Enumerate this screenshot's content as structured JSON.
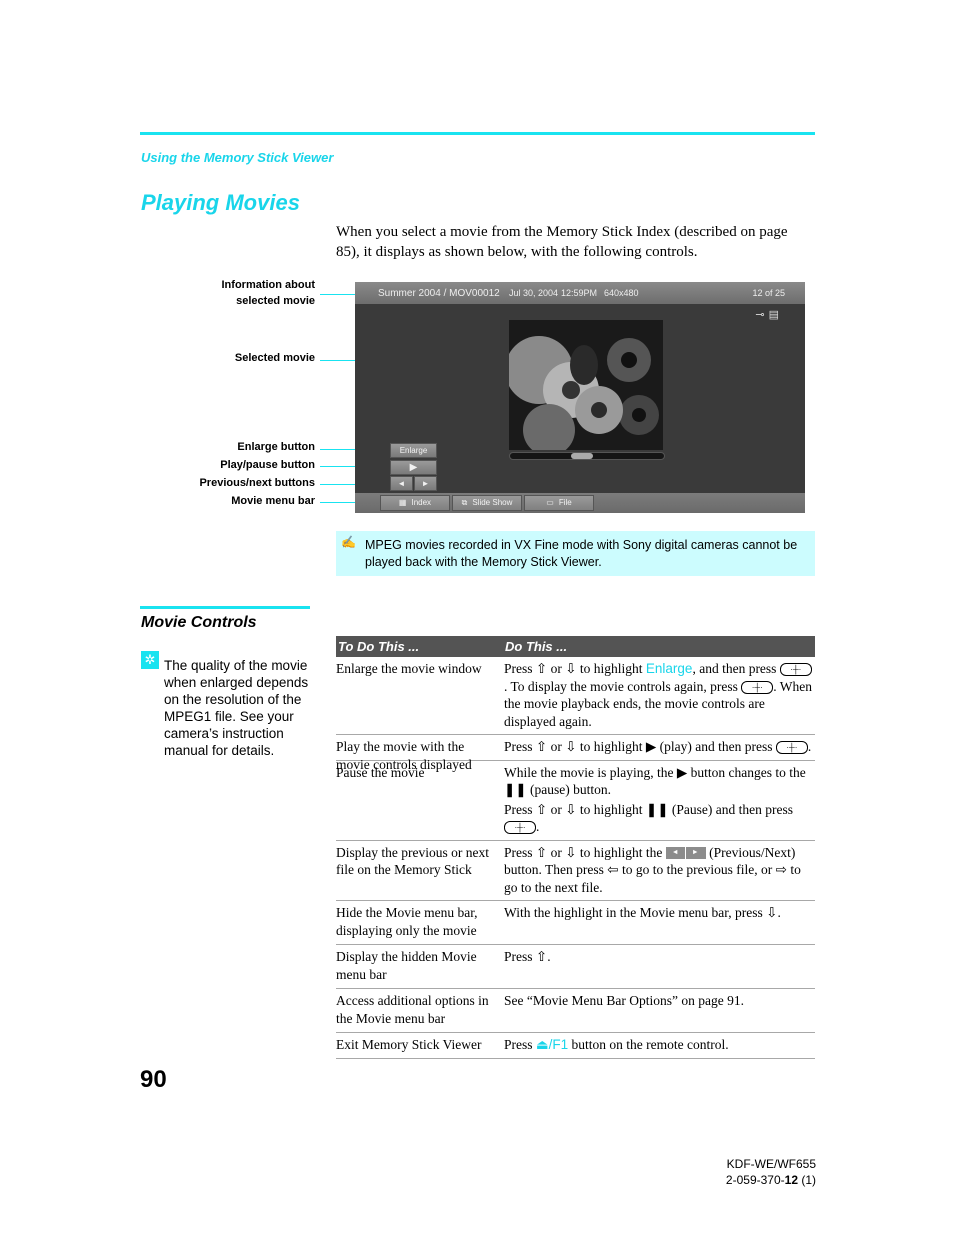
{
  "running_head": "Using the Memory Stick Viewer",
  "page_title": "Playing Movies",
  "intro": "When you select a movie from the Memory Stick Index (described on page 85), it displays as shown below, with the following controls.",
  "callouts": {
    "info_line1": "Information about",
    "info_line2": "selected movie",
    "selected_movie": "Selected movie",
    "enlarge_button": "Enlarge button",
    "play_pause_button": "Play/pause button",
    "prev_next_buttons": "Previous/next buttons",
    "movie_menu_bar": "Movie menu bar"
  },
  "screen": {
    "title": "Summer 2004 / MOV00012",
    "date": "Jul 30, 2004",
    "time": "12:59PM",
    "resolution": "640x480",
    "count": "12 of 25",
    "icons": [
      "key-icon",
      "film-icon"
    ],
    "progress_fraction": 0.46,
    "enlarge_label": "Enlarge",
    "play_glyph": "▶",
    "prev_glyph": "◄",
    "next_glyph": "►",
    "menu": {
      "index": "Index",
      "slide_show": "Slide Show",
      "file": "File"
    }
  },
  "note": {
    "icon": "✍",
    "text": "MPEG movies recorded in VX Fine mode with Sony digital cameras cannot be played back with the Memory Stick Viewer."
  },
  "section": {
    "title": "Movie Controls",
    "tip": "The quality of the movie when enlarged depends on the resolution of the MPEG1 file. See your camera’s instruction manual for details."
  },
  "table": {
    "headers": [
      "To Do This ...",
      "Do This ..."
    ],
    "rows": [
      {
        "task": "Enlarge the movie window",
        "p1_a": "Press ",
        "p1_b": " or ",
        "p1_c": " to highlight ",
        "p1_hl": "Enlarge",
        "p1_d": ", and then press ",
        "p1_e": ". To display the movie controls again, press ",
        "p1_f": ". When the movie playback ends, the movie controls are displayed again."
      },
      {
        "task": "Play the movie with the movie controls displayed",
        "p1_a": "Press ",
        "p1_b": " or ",
        "p1_c": " to highlight ",
        "p1_d": " (play) and then press ",
        "p1_e": "."
      },
      {
        "task": "Pause the movie",
        "p1_a": "While the movie is playing, the ",
        "p1_b": " button changes to the ",
        "p1_c": " (pause) button.",
        "p2_a": "Press ",
        "p2_b": " or ",
        "p2_c": " to highlight ",
        "p2_d": " (Pause) and then press ",
        "p2_e": "."
      },
      {
        "task": "Display the previous or next file on the Memory Stick",
        "p1_a": "Press ",
        "p1_b": " or ",
        "p1_c": " to highlight the ",
        "p1_d": " (Previous/Next) button. Then press ",
        "p1_e": " to go to the previous file, or ",
        "p1_f": " to go to the next file."
      },
      {
        "task": "Hide the Movie menu bar, displaying only the movie",
        "p1_a": "With the highlight in the Movie menu bar, press ",
        "p1_b": "."
      },
      {
        "task": "Display the hidden Movie menu bar",
        "p1_a": "Press ",
        "p1_b": "."
      },
      {
        "task": "Access additional options in the Movie menu bar",
        "p1_a": "See “Movie Menu Bar Options” on page 91."
      },
      {
        "task": "Exit Memory Stick Viewer",
        "p1_a": "Press ",
        "p1_hl": "/F1",
        "p1_b": " button on the remote control."
      }
    ],
    "glyphs": {
      "up": "⇧",
      "down": "⇩",
      "left": "⇦",
      "right": "⇨",
      "play": "▶",
      "pause": "❚❚",
      "joystick": "·┼·",
      "exit": "⏏"
    }
  },
  "footer": {
    "page_number": "90",
    "model": "KDF-WE/WF655",
    "code_a": "2-059-370-",
    "code_b": "12",
    "code_c": " (1)"
  }
}
